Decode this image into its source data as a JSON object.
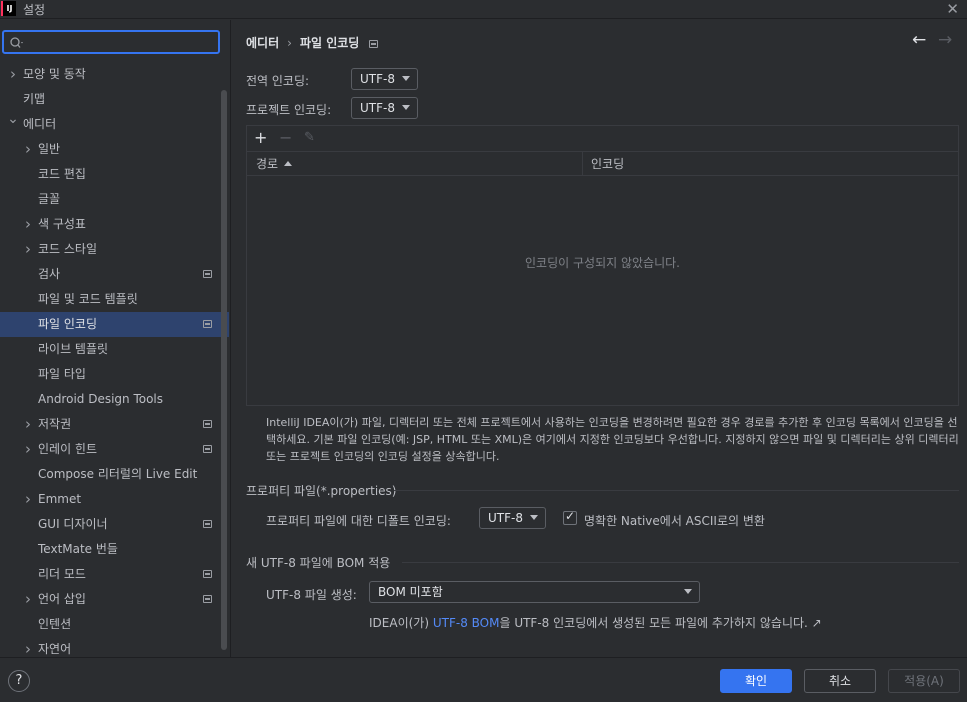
{
  "window": {
    "title": "설정",
    "logo_text": "IJ"
  },
  "search": {
    "placeholder": ""
  },
  "sidebar": {
    "items": [
      {
        "label": "모양 및 동작",
        "level": 0,
        "expandable": true,
        "expanded": false,
        "project_icon": false,
        "bold": true
      },
      {
        "label": "키맵",
        "level": 0,
        "expandable": false,
        "project_icon": false,
        "bold": true
      },
      {
        "label": "에디터",
        "level": 0,
        "expandable": true,
        "expanded": true,
        "project_icon": false,
        "bold": true
      },
      {
        "label": "일반",
        "level": 1,
        "expandable": true,
        "expanded": false,
        "project_icon": false
      },
      {
        "label": "코드 편집",
        "level": 1,
        "expandable": false,
        "project_icon": false
      },
      {
        "label": "글꼴",
        "level": 1,
        "expandable": false,
        "project_icon": false
      },
      {
        "label": "색 구성표",
        "level": 1,
        "expandable": true,
        "expanded": false,
        "project_icon": false
      },
      {
        "label": "코드 스타일",
        "level": 1,
        "expandable": true,
        "expanded": false,
        "project_icon": false
      },
      {
        "label": "검사",
        "level": 1,
        "expandable": false,
        "project_icon": true
      },
      {
        "label": "파일 및 코드 템플릿",
        "level": 1,
        "expandable": false,
        "project_icon": false
      },
      {
        "label": "파일 인코딩",
        "level": 1,
        "expandable": false,
        "project_icon": true,
        "selected": true
      },
      {
        "label": "라이브 템플릿",
        "level": 1,
        "expandable": false,
        "project_icon": false
      },
      {
        "label": "파일 타입",
        "level": 1,
        "expandable": false,
        "project_icon": false
      },
      {
        "label": "Android Design Tools",
        "level": 1,
        "expandable": false,
        "project_icon": false
      },
      {
        "label": "저작권",
        "level": 1,
        "expandable": true,
        "expanded": false,
        "project_icon": true
      },
      {
        "label": "인레이 힌트",
        "level": 1,
        "expandable": true,
        "expanded": false,
        "project_icon": true
      },
      {
        "label": "Compose 리터럴의 Live Edit",
        "level": 1,
        "expandable": false,
        "project_icon": false
      },
      {
        "label": "Emmet",
        "level": 1,
        "expandable": true,
        "expanded": false,
        "project_icon": false
      },
      {
        "label": "GUI 디자이너",
        "level": 1,
        "expandable": false,
        "project_icon": true
      },
      {
        "label": "TextMate 번들",
        "level": 1,
        "expandable": false,
        "project_icon": false
      },
      {
        "label": "리더 모드",
        "level": 1,
        "expandable": false,
        "project_icon": true
      },
      {
        "label": "언어 삽입",
        "level": 1,
        "expandable": true,
        "expanded": false,
        "project_icon": true
      },
      {
        "label": "인텐션",
        "level": 1,
        "expandable": false,
        "project_icon": false
      },
      {
        "label": "자연어",
        "level": 1,
        "expandable": true,
        "expanded": false,
        "project_icon": false
      }
    ]
  },
  "breadcrumb": {
    "parent": "에디터",
    "separator": "›",
    "current": "파일 인코딩"
  },
  "global_encoding": {
    "label": "전역 인코딩:",
    "value": "UTF-8"
  },
  "project_encoding": {
    "label": "프로젝트 인코딩:",
    "value": "UTF-8"
  },
  "table": {
    "toolbar": {
      "add": "+",
      "remove": "−",
      "edit": "✎"
    },
    "columns": [
      "경로",
      "인코딩"
    ],
    "empty_text": "인코딩이 구성되지 않았습니다."
  },
  "description": "IntelliJ IDEA이(가) 파일, 디렉터리 또는 전체 프로젝트에서 사용하는 인코딩을 변경하려면 필요한 경우 경로를 추가한 후 인코딩 목록에서 인코딩을 선택하세요. 기본 파일 인코딩(예: JSP, HTML 또는 XML)은 여기에서 지정한 인코딩보다 우선합니다. 지정하지 않으면 파일 및 디렉터리는 상위 디렉터리 또는 프로젝트 인코딩의 인코딩 설정을 상속합니다.",
  "properties": {
    "section_title": "프로퍼티 파일(*.properties)",
    "default_label": "프로퍼티 파일에 대한 디폴트 인코딩:",
    "default_value": "UTF-8",
    "native_checkbox_label": "명확한 Native에서 ASCII로의 변환",
    "native_checked": true
  },
  "bom": {
    "section_title": "새 UTF-8 파일에 BOM 적용",
    "create_label": "UTF-8 파일 생성:",
    "create_value": "BOM 미포함",
    "note_prefix": "IDEA이(가) ",
    "note_link": "UTF-8 BOM",
    "note_suffix": "을 UTF-8 인코딩에서 생성된 모든 파일에 추가하지 않습니다. ↗"
  },
  "footer": {
    "help": "?",
    "ok": "확인",
    "cancel": "취소",
    "apply": "적용(A)"
  },
  "colors": {
    "accent": "#3574f0",
    "selection": "#2e436e",
    "link": "#548af7",
    "background": "#2b2d30"
  }
}
